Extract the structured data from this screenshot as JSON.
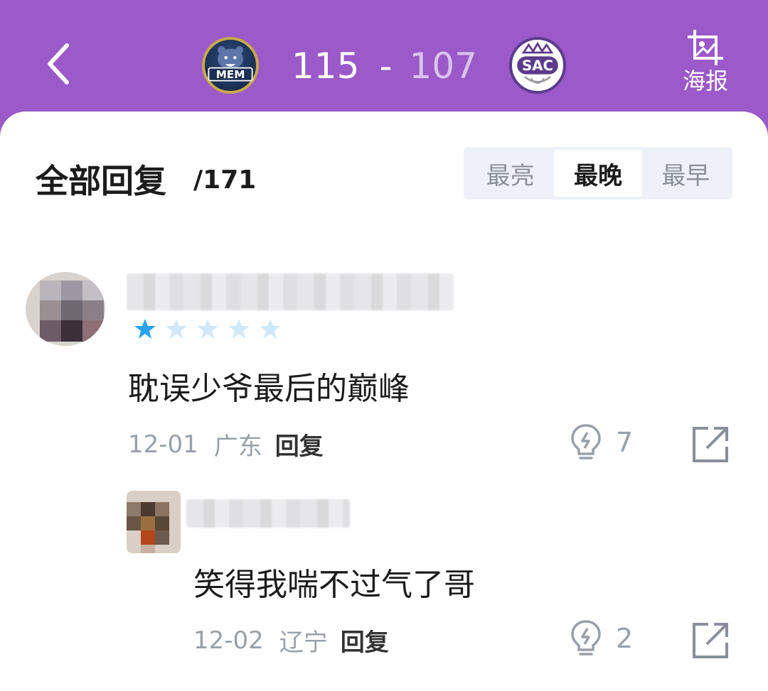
{
  "header": {
    "home_team": "MEM",
    "away_team": "SAC",
    "home_score": "115",
    "separator": "-",
    "away_score": "107",
    "poster_label": "海报"
  },
  "replies": {
    "title": "全部回复",
    "count": "/171",
    "sort_tabs": [
      "最亮",
      "最晚",
      "最早"
    ],
    "active_sort": "最晚"
  },
  "comments": [
    {
      "rating": 1,
      "rating_max": 5,
      "text": "耽误少爷最后的巅峰",
      "date": "12-01",
      "location": "广东",
      "reply_label": "回复",
      "likes": "7"
    },
    {
      "text": "笑得我喘不过气了哥",
      "date": "12-02",
      "location": "辽宁",
      "reply_label": "回复",
      "likes": "2"
    }
  ],
  "colors": {
    "header_bg": "#9b59c9",
    "star_active": "#2aa3f0",
    "star_inactive": "#cfe8fb"
  }
}
